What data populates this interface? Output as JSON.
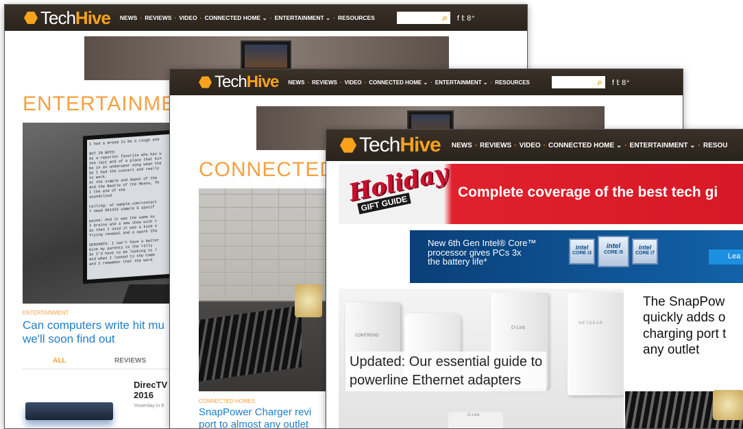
{
  "brand": {
    "tech": "Tech",
    "hive": "Hive"
  },
  "nav": {
    "items": [
      "NEWS",
      "REVIEWS",
      "VIDEO",
      "CONNECTED HOME ⌄",
      "ENTERTAINMENT ⌄",
      "RESOURCES"
    ],
    "third_items": [
      "NEWS",
      "REVIEWS",
      "VIDEO",
      "CONNECTED HOME ⌄",
      "ENTERTAINMENT ⌄",
      "RESOU"
    ],
    "search_glyph": "⌕",
    "social": "f  𝕥  8⁺"
  },
  "window1": {
    "section_title": "ENTERTAINMEN",
    "kicker": "ENTERTAINMENT",
    "headline": "Can computers write hit mu\nwe'll soon find out",
    "tabs": [
      "ALL",
      "REVIEWS"
    ],
    "list_item_title": "DirecTV\n2016",
    "list_item_meta": "Yesterday in E",
    "screen_lines": [
      "I had a dream to be a rough and",
      "",
      "OUT IN BOYS:",
      "As a reporter favorite who has w",
      "the last end of a place that kin",
      "be in an underwear song when the",
      "So I had the concert and really",
      "to work.",
      "At the simple and depot of the",
      "And the Beatle of the Means, Th",
      "I the end of the",
      "soundcloud",
      "",
      "Calling: at sample.com/contact",
      "7 need 961332 sample 5 spotif",
      "",
      "pause: And it was the same nu",
      "2 brains and a new show with t",
      "So then I said it was a kind o",
      "Trying renewal and a spark tha",
      "",
      "SERVANTS: I can't have a better",
      "Give my parents to the rally",
      "So I'd have to be looking to l",
      "And when I looked to the Comm",
      "and I remember that the word"
    ]
  },
  "window2": {
    "section_title": "CONNECTED H",
    "kicker": "CONNECTED HOMES",
    "headline": "SnapPower Charger revi\nport to almost any outlet"
  },
  "window3": {
    "promo_script": "Holiday",
    "promo_sub": "GIFT GUIDE",
    "promo_text": "Complete coverage of the best tech gi",
    "intel_text": "New 6th Gen Intel® Core™\nprocessor gives PCs 3x\nthe battery life*",
    "intel_badges": [
      "CORE i3",
      "CORE i5",
      "CORE i7"
    ],
    "intel_badge_brand": "intel",
    "intel_cta": "Lea",
    "main_caption": "Updated: Our essential guide to\npowerline Ethernet adapters",
    "side_caption": "The SnapPow\nquickly adds o\ncharging port t\nany outlet",
    "device_labels": [
      "COMTREND",
      "D-Link",
      "NETGEAR",
      "D-Link"
    ]
  },
  "colors": {
    "brand_orange": "#f8a21b",
    "link_blue": "#1e7ec8",
    "nav_bg": "#2f2720",
    "promo_red": "#e0202c",
    "intel_blue": "#0a4d8c"
  }
}
